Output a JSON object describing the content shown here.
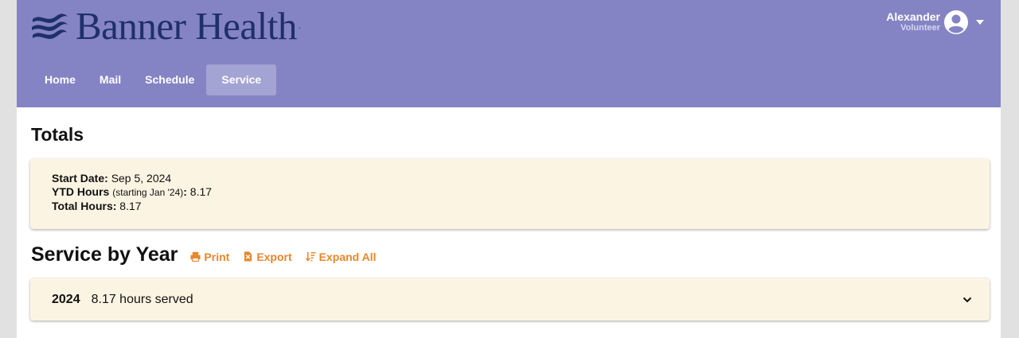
{
  "brand": {
    "name": "Banner Health",
    "mark": "."
  },
  "user": {
    "name": "Alexander",
    "role": "Volunteer"
  },
  "nav": [
    {
      "label": "Home",
      "active": false
    },
    {
      "label": "Mail",
      "active": false
    },
    {
      "label": "Schedule",
      "active": false
    },
    {
      "label": "Service",
      "active": true
    }
  ],
  "totals": {
    "title": "Totals",
    "start_label": "Start Date:",
    "start_value": "Sep 5, 2024",
    "ytd_label": "YTD Hours",
    "ytd_note": "(starting Jan '24)",
    "ytd_colon": ":",
    "ytd_value": "8.17",
    "total_label": "Total Hours:",
    "total_value": "8.17"
  },
  "service_by_year": {
    "title": "Service by Year",
    "actions": {
      "print": "Print",
      "export": "Export",
      "expand": "Expand All"
    },
    "accent_color": "#e8862b",
    "rows": [
      {
        "year": "2024",
        "summary": "8.17 hours served"
      }
    ]
  },
  "colors": {
    "header": "#8484c5",
    "card": "#fcf4e2",
    "logo": "#1f2f6b"
  }
}
